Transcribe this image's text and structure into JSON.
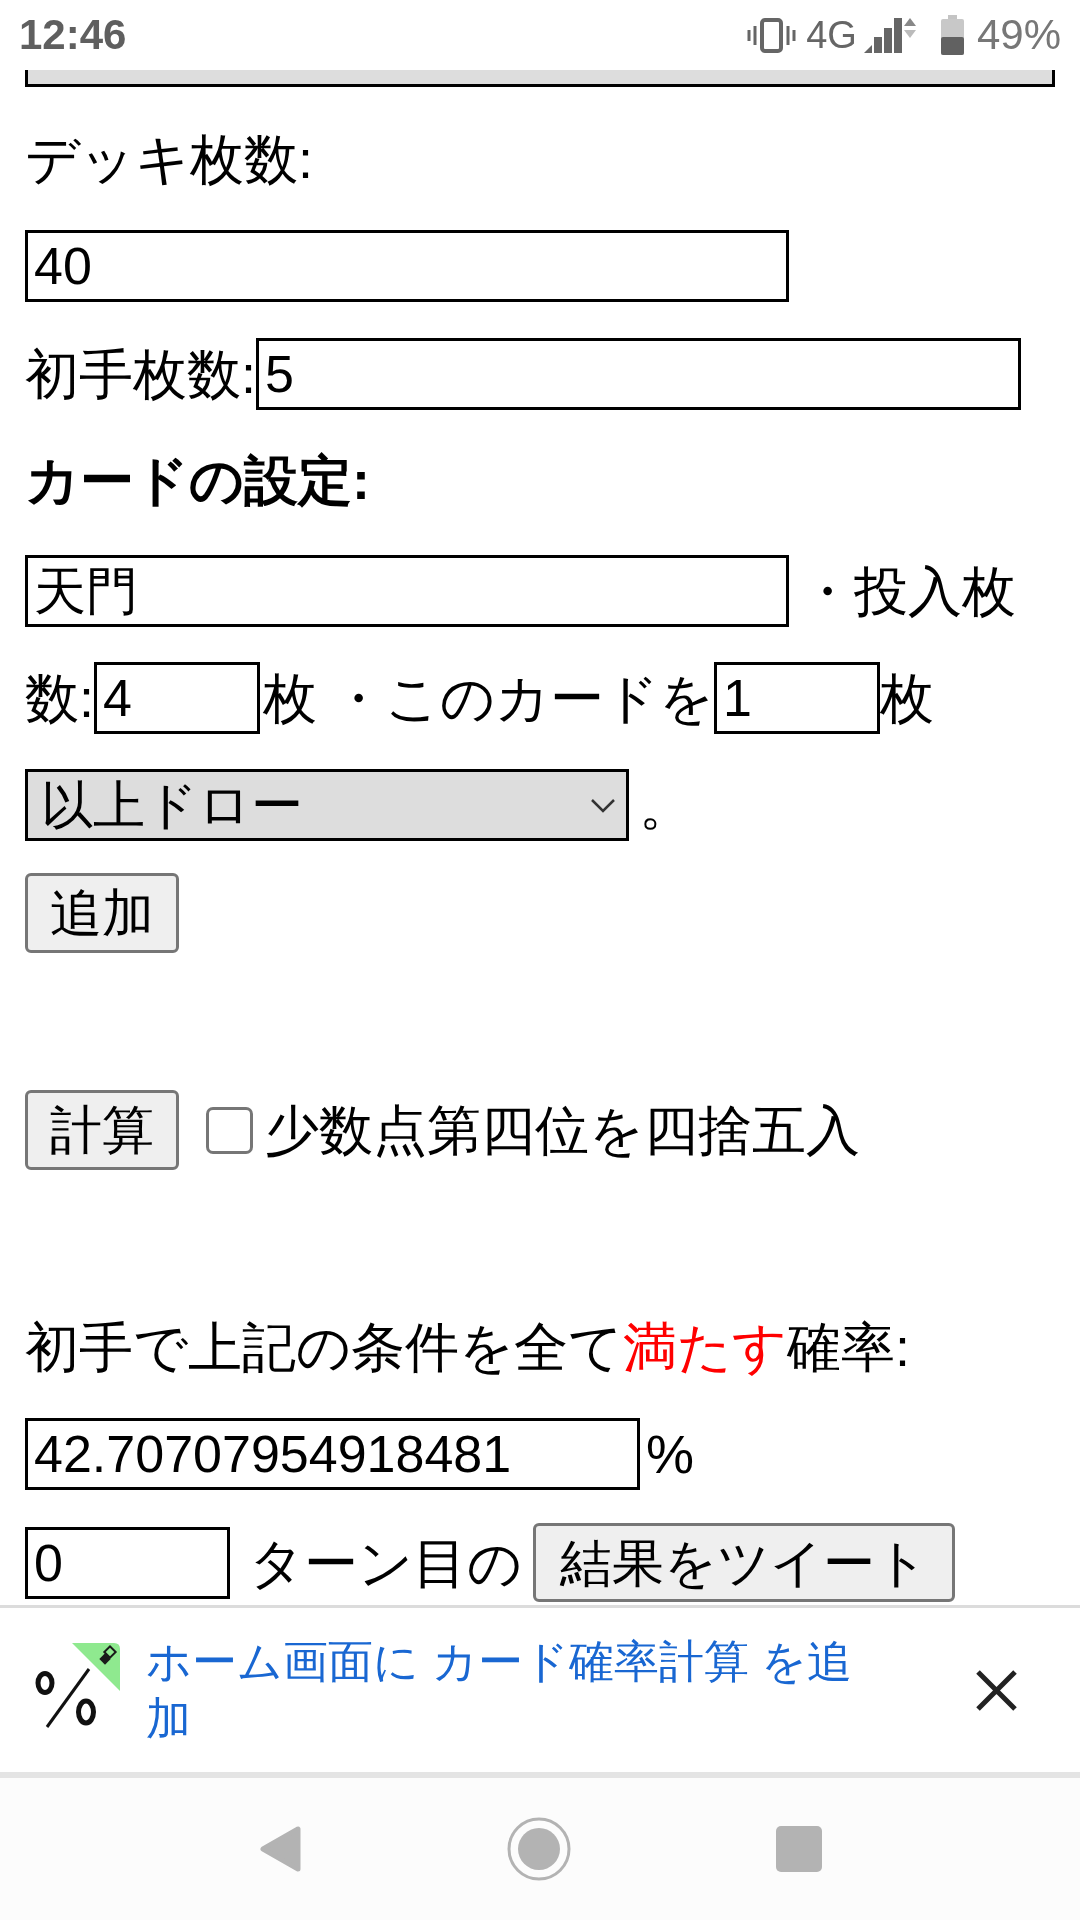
{
  "status_bar": {
    "time": "12:46",
    "network": "4G",
    "battery": "49%"
  },
  "form": {
    "deck_size_label": "デッキ枚数:",
    "deck_size": "40",
    "hand_size_label": "初手枚数:",
    "hand_size": "5",
    "card_heading": "カードの設定:",
    "card_name": "天門",
    "copies_label": [
      "・投入枚",
      "数:"
    ],
    "copies": "4",
    "copies_unit": "枚",
    "draw_label": "・このカードを",
    "draw_count": "1",
    "draw_unit": "枚",
    "condition": "以上ドロー",
    "condition_end": "。",
    "add_button": "追加"
  },
  "calculate": {
    "button": "計算",
    "round_option": {
      "label": "少数点第四位を四捨五入",
      "checked": false
    }
  },
  "result": {
    "label": [
      {
        "text": "初手で上記の条件を全て",
        "emphasis": false
      },
      {
        "text": "満たす",
        "emphasis": true
      },
      {
        "text": "確率:",
        "emphasis": false
      }
    ],
    "value": "42.70707954918481",
    "unit": "%",
    "turn": "0",
    "turn_label": "ターン目の",
    "tweet_button": "結果をツイート"
  },
  "install_banner": {
    "text": "ホーム画面に カード確率計算 を追加"
  }
}
